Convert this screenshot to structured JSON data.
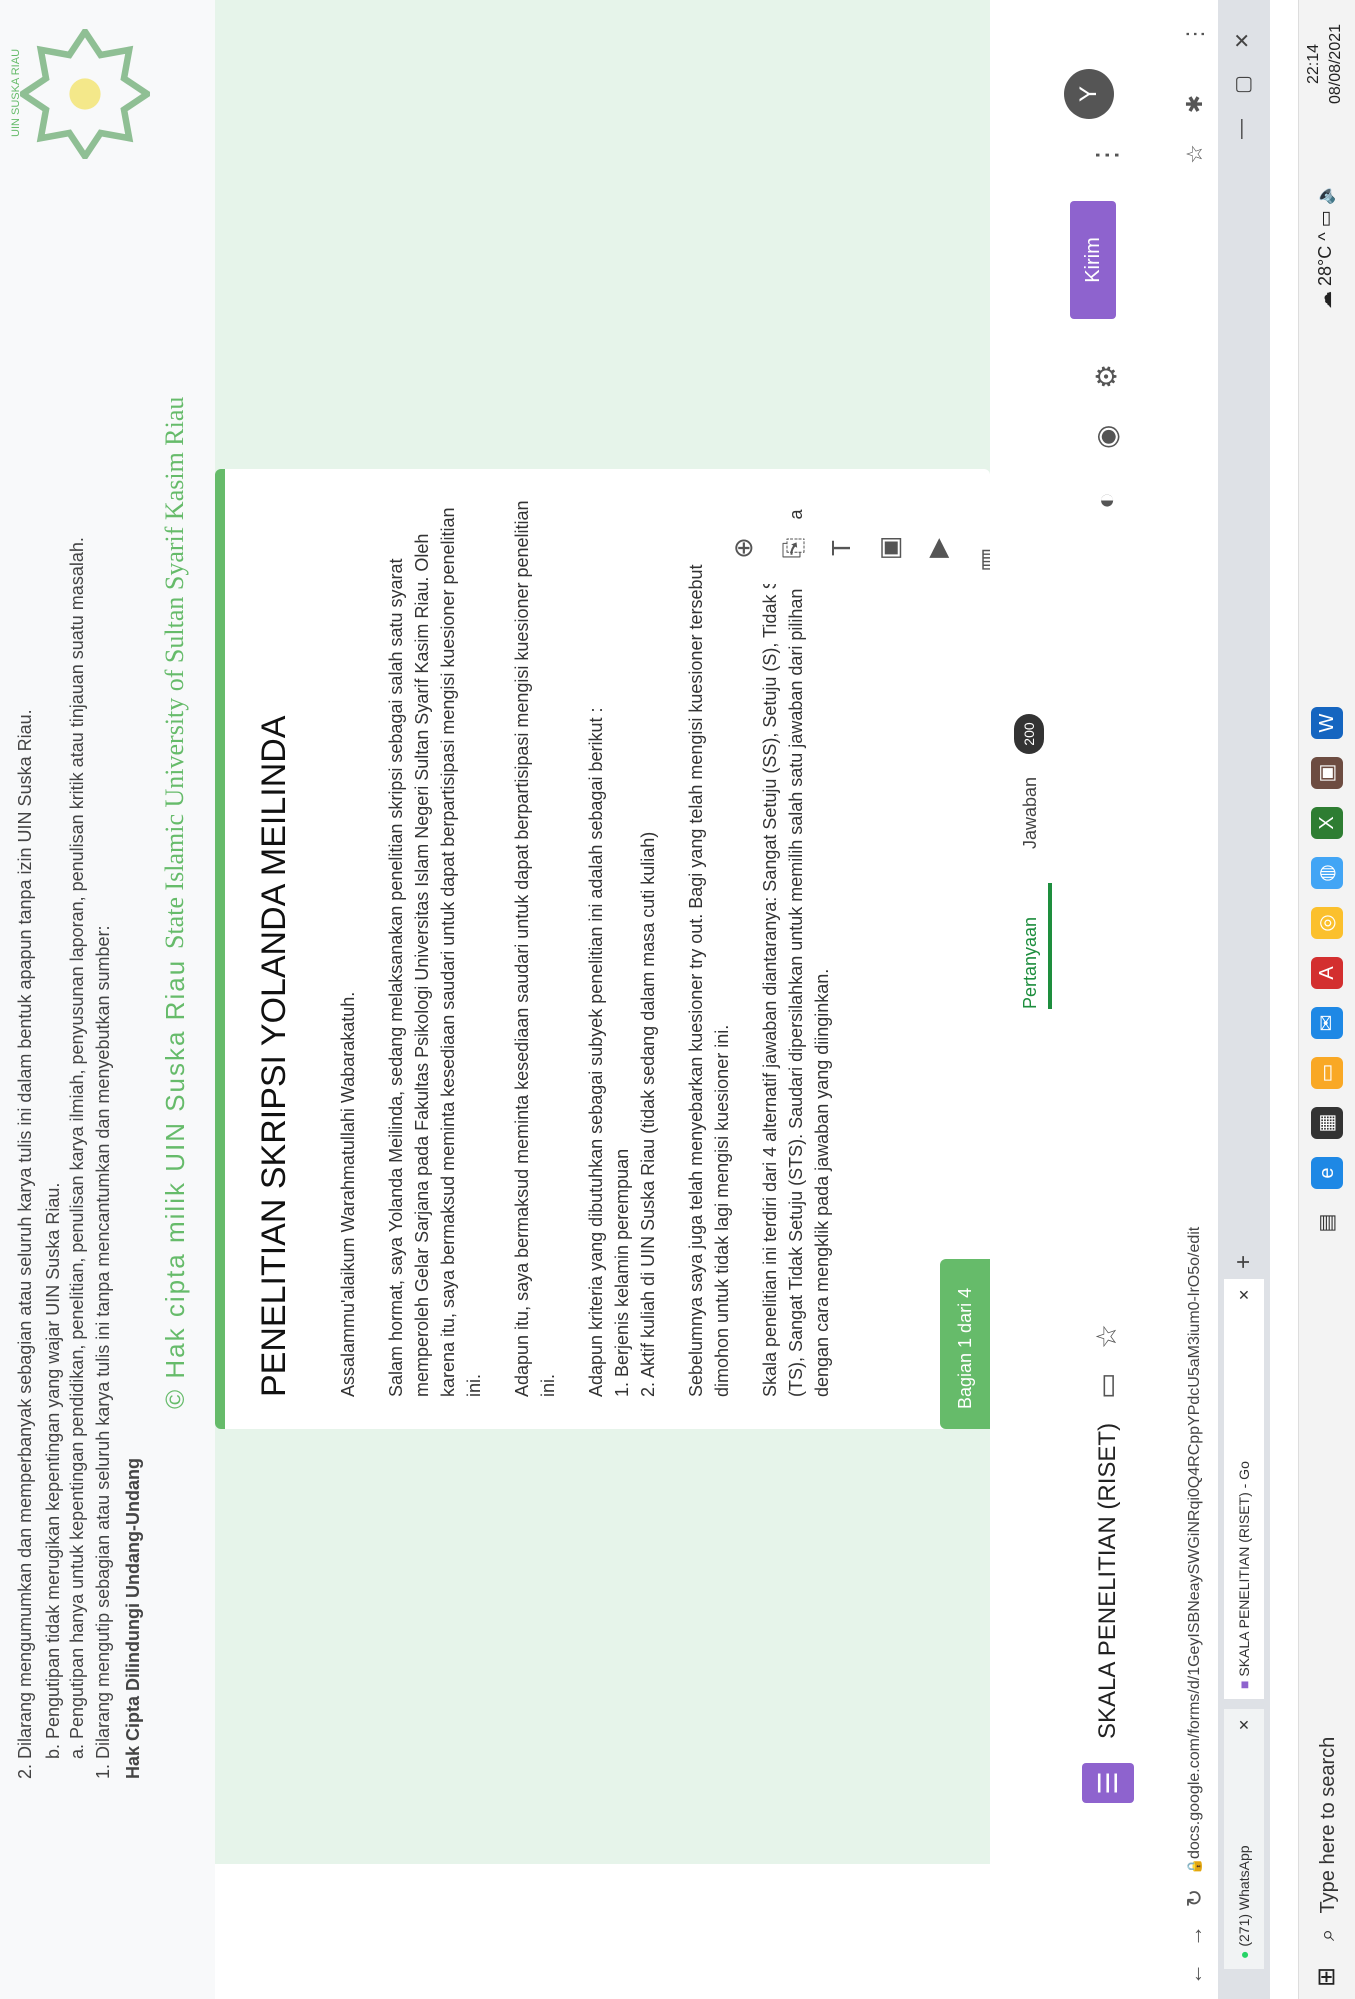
{
  "taskbar": {
    "search_placeholder": "Type here to search",
    "time": "22:14",
    "date": "08/08/2021",
    "temperature": "28°C"
  },
  "browser": {
    "tabs": [
      {
        "label": "(271) WhatsApp"
      },
      {
        "label": "SKALA PENELITIAN (RISET) - Go"
      }
    ],
    "url": "docs.google.com/forms/d/1GeyISBNeaySWGiNRqi0Q4RCppYPdcU5aM3ium0-lrO5o/edit"
  },
  "forms": {
    "doc_title": "SKALA PENELITIAN (RISET)",
    "send_label": "Kirim",
    "avatar_letter": "Y",
    "tabs": {
      "questions": "Pertanyaan",
      "responses": "Jawaban",
      "responses_count": "200"
    },
    "section_label": "Bagian 1 dari 4",
    "card": {
      "title": "PENELITIAN SKRIPSI YOLANDA MEILINDA",
      "paragraphs": [
        "Assalammu'alaikum Warahmatullahi Wabarakatuh.",
        "Salam hormat, saya Yolanda Meilinda, sedang melaksanakan penelitian skripsi sebagai salah satu syarat memperoleh Gelar Sarjana pada Fakultas Psikologi Universitas Islam Negeri Sultan Syarif Kasim Riau. Oleh karena itu, saya bermaksud meminta kesediaan saudari untuk dapat berpartisipasi mengisi kuesioner penelitian ini.",
        "Adapun itu, saya bermaksud meminta kesediaan saudari untuk dapat berpartisipasi mengisi kuesioner penelitian ini.",
        "Adapun kriteria yang dibutuhkan sebagai subyek penelitian ini adalah sebagai berikut :",
        "1. Berjenis kelamin perempuan",
        "2. Aktif kuliah di UIN Suska Riau (tidak sedang dalam masa cuti kuliah)",
        "Sebelumnya saya juga telah menyebarkan kuesioner try out. Bagi yang telah mengisi kuesioner tersebut dimohon untuk tidak lagi mengisi kuesioner ini.",
        "Skala penelitian ini terdiri dari 4 alternatif jawaban diantaranya: Sangat Setuju (SS), Setuju (S), Tidak Setuju (TS), Sangat Tidak Setuju (STS). Saudari dipersilahkan untuk memilih salah satu jawaban dari pilihan yang ada dengan cara mengklik pada jawaban yang diinginkan."
      ]
    }
  },
  "margin": {
    "watermark_top": "© Hak cipta milik UIN Suska Riau",
    "watermark_bottom": "State Islamic University of Sultan Syarif Kasim Riau",
    "logo_caption": "UIN SUSKA RIAU",
    "heading": "Hak Cipta Dilindungi Undang-Undang",
    "lines": [
      "1. Dilarang mengutip sebagian atau seluruh karya tulis ini tanpa mencantumkan dan menyebutkan sumber:",
      "a. Pengutipan hanya untuk kepentingan pendidikan, penelitian, penulisan karya ilmiah, penyusunan laporan, penulisan kritik atau tinjauan suatu masalah.",
      "b. Pengutipan tidak merugikan kepentingan yang wajar UIN Suska Riau.",
      "2. Dilarang mengumumkan dan memperbanyak sebagian atau seluruh karya tulis ini dalam bentuk apapun tanpa izin UIN Suska Riau."
    ]
  },
  "colors": {
    "accent_purple": "#8e63ce",
    "accent_green": "#66bb6a"
  }
}
